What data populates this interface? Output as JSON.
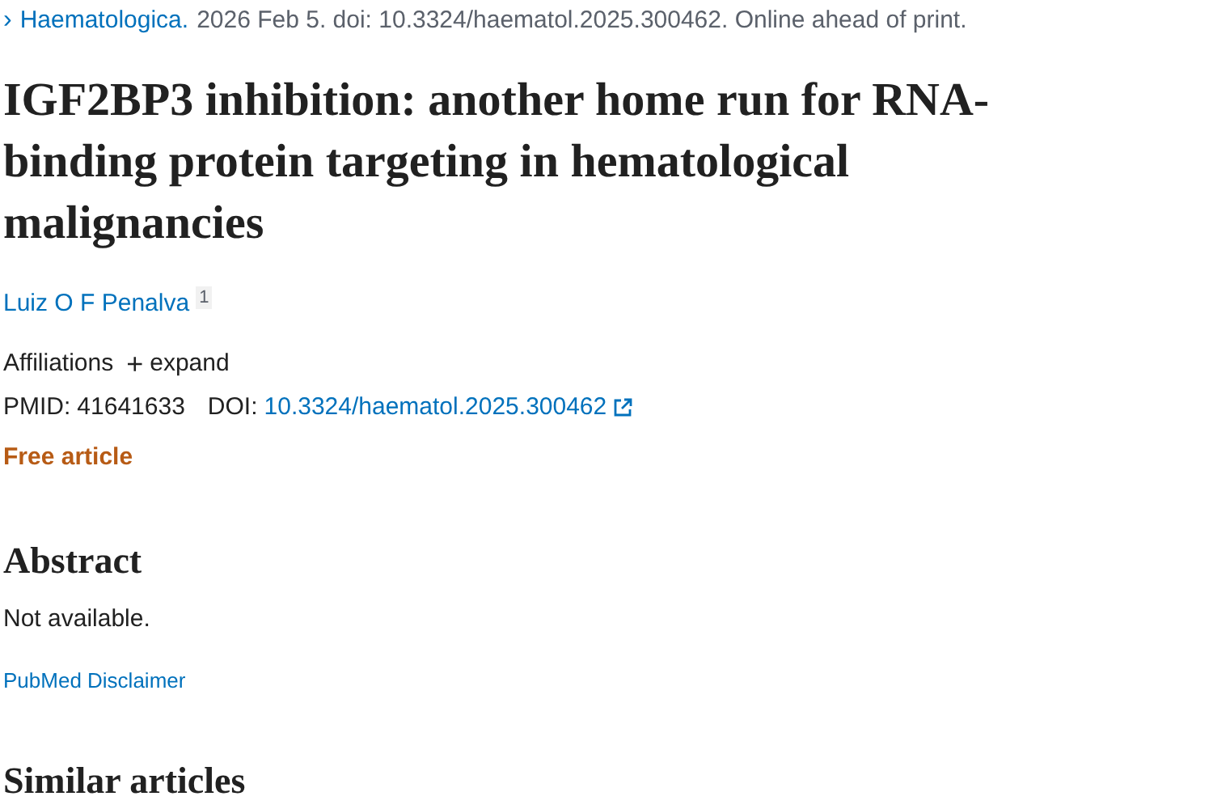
{
  "citation": {
    "icon": "›",
    "journal": "Haematologica.",
    "details": "2026 Feb 5. doi: 10.3324/haematol.2025.300462. Online ahead of print."
  },
  "title": "IGF2BP3 inhibition: another home run for RNA-binding protein targeting in hematological malignancies",
  "authors": [
    {
      "name": "Luiz O F Penalva",
      "affiliation_mark": "1"
    }
  ],
  "affiliations": {
    "label": "Affiliations",
    "toggle_icon": "+",
    "toggle": "expand",
    "expanded": false
  },
  "identifiers": {
    "pmid_label": "PMID:",
    "pmid": "41641633",
    "doi_label": "DOI:",
    "doi": "10.3324/haematol.2025.300462"
  },
  "access_label": "Free article",
  "abstract": {
    "heading": "Abstract",
    "text": "Not available."
  },
  "disclaimer_link": "PubMed Disclaimer",
  "similar_heading": "Similar articles"
}
